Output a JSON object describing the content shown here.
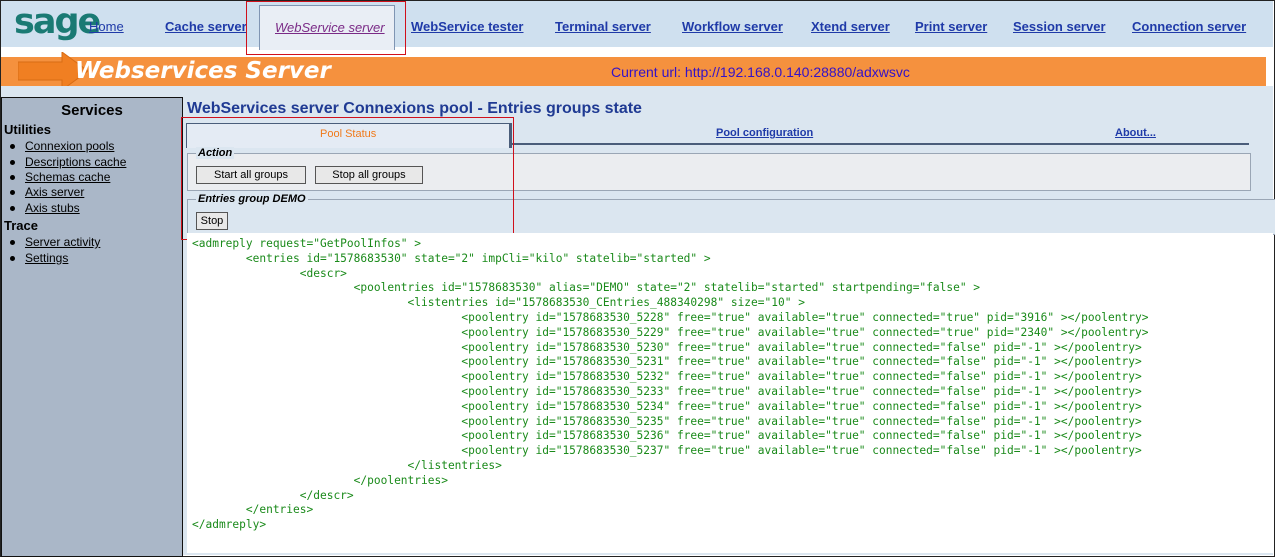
{
  "topnav": {
    "logo": "sage",
    "links": [
      {
        "label": "Home"
      },
      {
        "label": "Cache server"
      },
      {
        "label": "WebService server"
      },
      {
        "label": "WebService tester"
      },
      {
        "label": "Terminal server"
      },
      {
        "label": "Workflow server"
      },
      {
        "label": "Xtend server"
      },
      {
        "label": "Print server"
      },
      {
        "label": "Session server"
      },
      {
        "label": "Connection server"
      }
    ]
  },
  "banner": {
    "title": "Webservices Server",
    "current_url_label": "Current url: http://192.168.0.140:28880/adxwsvc",
    "color": "#f5913e"
  },
  "sidebar": {
    "title": "Services",
    "sections": [
      {
        "label": "Utilities",
        "items": [
          "Connexion pools",
          "Descriptions cache",
          "Schemas cache",
          "Axis server",
          "Axis stubs"
        ]
      },
      {
        "label": "Trace",
        "items": [
          "Server activity",
          "Settings"
        ]
      }
    ]
  },
  "main": {
    "title": "WebServices server Connexions pool - Entries groups state",
    "tabs": [
      {
        "label": "Pool Status",
        "active": true
      },
      {
        "label": "Pool configuration"
      },
      {
        "label": "About..."
      }
    ],
    "action_legend": "Action",
    "start_all_label": "Start all groups",
    "stop_all_label": "Stop all groups",
    "group_legend": "Entries group DEMO",
    "stop_label": "Stop",
    "xml_lines": [
      "<admreply request=\"GetPoolInfos\" >",
      "        <entries id=\"1578683530\" state=\"2\" impCli=\"kilo\" statelib=\"started\" >",
      "                <descr>",
      "                        <poolentries id=\"1578683530\" alias=\"DEMO\" state=\"2\" statelib=\"started\" startpending=\"false\" >",
      "                                <listentries id=\"1578683530_CEntries_488340298\" size=\"10\" >",
      "                                        <poolentry id=\"1578683530_5228\" free=\"true\" available=\"true\" connected=\"true\" pid=\"3916\" ></poolentry>",
      "                                        <poolentry id=\"1578683530_5229\" free=\"true\" available=\"true\" connected=\"true\" pid=\"2340\" ></poolentry>",
      "                                        <poolentry id=\"1578683530_5230\" free=\"true\" available=\"true\" connected=\"false\" pid=\"-1\" ></poolentry>",
      "                                        <poolentry id=\"1578683530_5231\" free=\"true\" available=\"true\" connected=\"false\" pid=\"-1\" ></poolentry>",
      "                                        <poolentry id=\"1578683530_5232\" free=\"true\" available=\"true\" connected=\"false\" pid=\"-1\" ></poolentry>",
      "                                        <poolentry id=\"1578683530_5233\" free=\"true\" available=\"true\" connected=\"false\" pid=\"-1\" ></poolentry>",
      "                                        <poolentry id=\"1578683530_5234\" free=\"true\" available=\"true\" connected=\"false\" pid=\"-1\" ></poolentry>",
      "                                        <poolentry id=\"1578683530_5235\" free=\"true\" available=\"true\" connected=\"false\" pid=\"-1\" ></poolentry>",
      "                                        <poolentry id=\"1578683530_5236\" free=\"true\" available=\"true\" connected=\"false\" pid=\"-1\" ></poolentry>",
      "                                        <poolentry id=\"1578683530_5237\" free=\"true\" available=\"true\" connected=\"false\" pid=\"-1\" ></poolentry>",
      "                                </listentries>",
      "                        </poolentries>",
      "                </descr>",
      "        </entries>",
      "</admreply>"
    ]
  }
}
